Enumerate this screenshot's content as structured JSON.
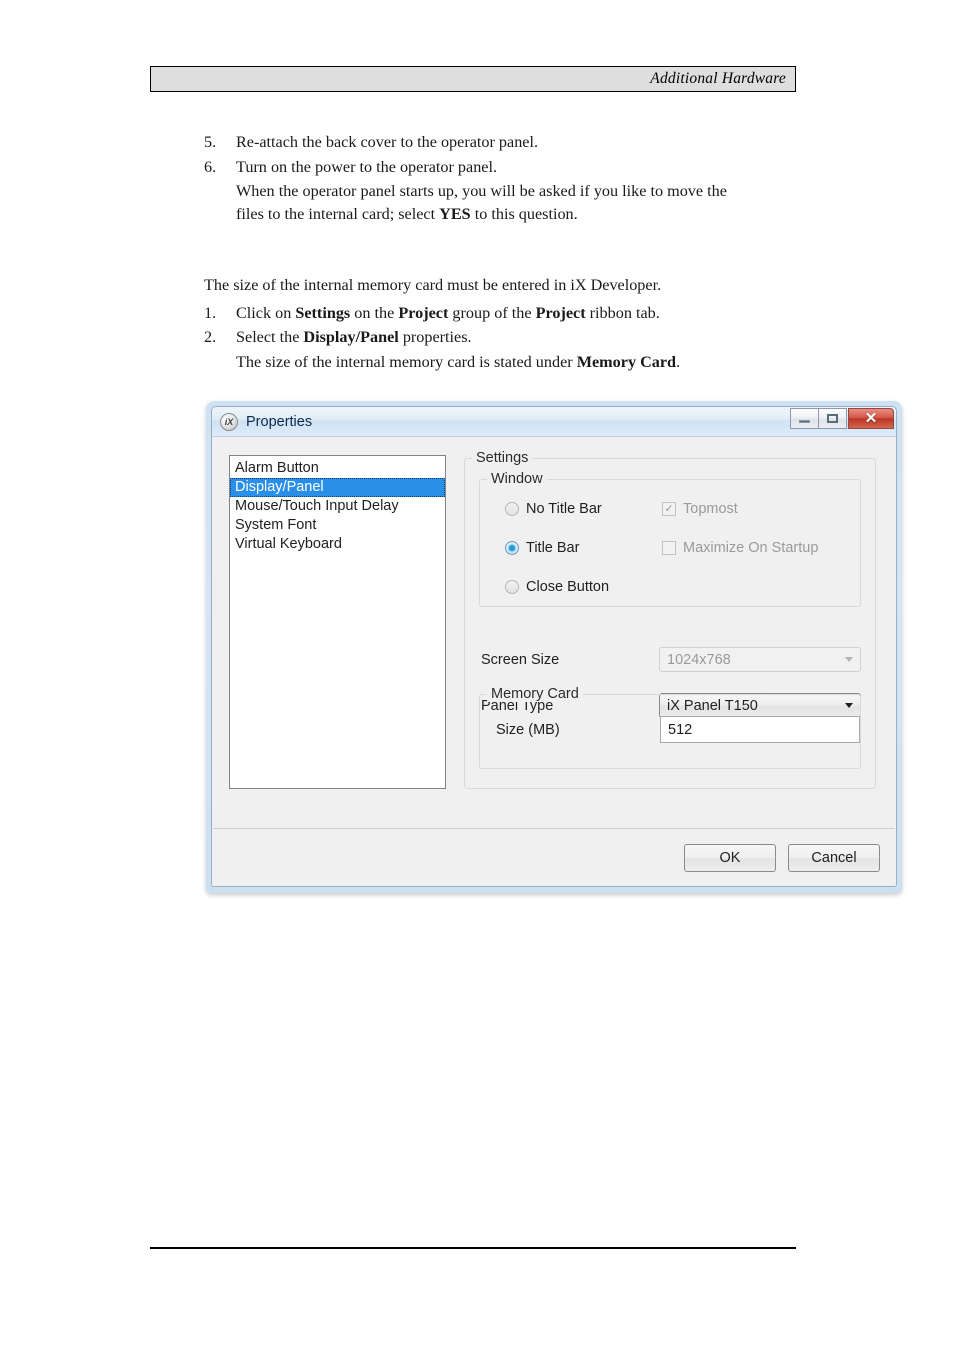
{
  "page": {
    "header_title": "Additional Hardware"
  },
  "document": {
    "steps_first": [
      {
        "num": "5.",
        "text": "Re-attach the back cover to the operator panel."
      },
      {
        "num": "6.",
        "text": "Turn on the power to the operator panel."
      }
    ],
    "step6_note_line1": "When the operator panel starts up, you will be asked if you like to move the",
    "step6_note_line2_pre": "files to the internal card; select ",
    "step6_note_line2_bold": "YES",
    "step6_note_line2_post": " to this question.",
    "intro_paragraph": "The size of the internal memory card must be entered in iX Developer.",
    "step1_num": "1.",
    "step1_pre": "Click on ",
    "step1_b1": "Settings",
    "step1_mid1": " on the ",
    "step1_b2": "Project",
    "step1_mid2": " group of the ",
    "step1_b3": "Project",
    "step1_post": " ribbon tab.",
    "step2_num": "2.",
    "step2_pre": "Select the ",
    "step2_b1": "Display/Panel",
    "step2_post": " properties.",
    "step2_note_pre": "The size of the internal memory card is stated under ",
    "step2_note_bold": "Memory Card",
    "step2_note_post": "."
  },
  "dialog": {
    "title": "Properties",
    "app_icon_text": "iX",
    "window_controls": {
      "minimize": "minimize-button",
      "maximize": "maximize-button",
      "close_glyph": "✕"
    },
    "list": {
      "items": [
        {
          "label": "Alarm Button",
          "selected": false
        },
        {
          "label": "Display/Panel",
          "selected": true
        },
        {
          "label": "Mouse/Touch Input Delay",
          "selected": false
        },
        {
          "label": "System Font",
          "selected": false
        },
        {
          "label": "Virtual Keyboard",
          "selected": false
        }
      ]
    },
    "settings_group_label": "Settings",
    "window_group_label": "Window",
    "radios": [
      {
        "label": "No Title Bar",
        "checked": false
      },
      {
        "label": "Title Bar",
        "checked": true
      },
      {
        "label": "Close Button",
        "checked": false
      }
    ],
    "checkboxes": [
      {
        "label": "Topmost",
        "checked": true,
        "disabled": true,
        "glyph": "✓"
      },
      {
        "label": "Maximize On Startup",
        "checked": false,
        "disabled": true,
        "glyph": ""
      }
    ],
    "screen_size": {
      "label": "Screen Size",
      "value": "1024x768",
      "disabled": true
    },
    "panel_type": {
      "label": "Panel Type",
      "value": "iX Panel T150",
      "disabled": false
    },
    "memory_card": {
      "group_label": "Memory Card",
      "size_label": "Size (MB)",
      "size_value": "512"
    },
    "buttons": {
      "ok": "OK",
      "cancel": "Cancel"
    },
    "colors": {
      "selection_blue": "#2a8fe8",
      "radio_dot": "#1ba1d9",
      "close_red": "#bb3523",
      "aero_frame": "#cfe2f4"
    }
  }
}
